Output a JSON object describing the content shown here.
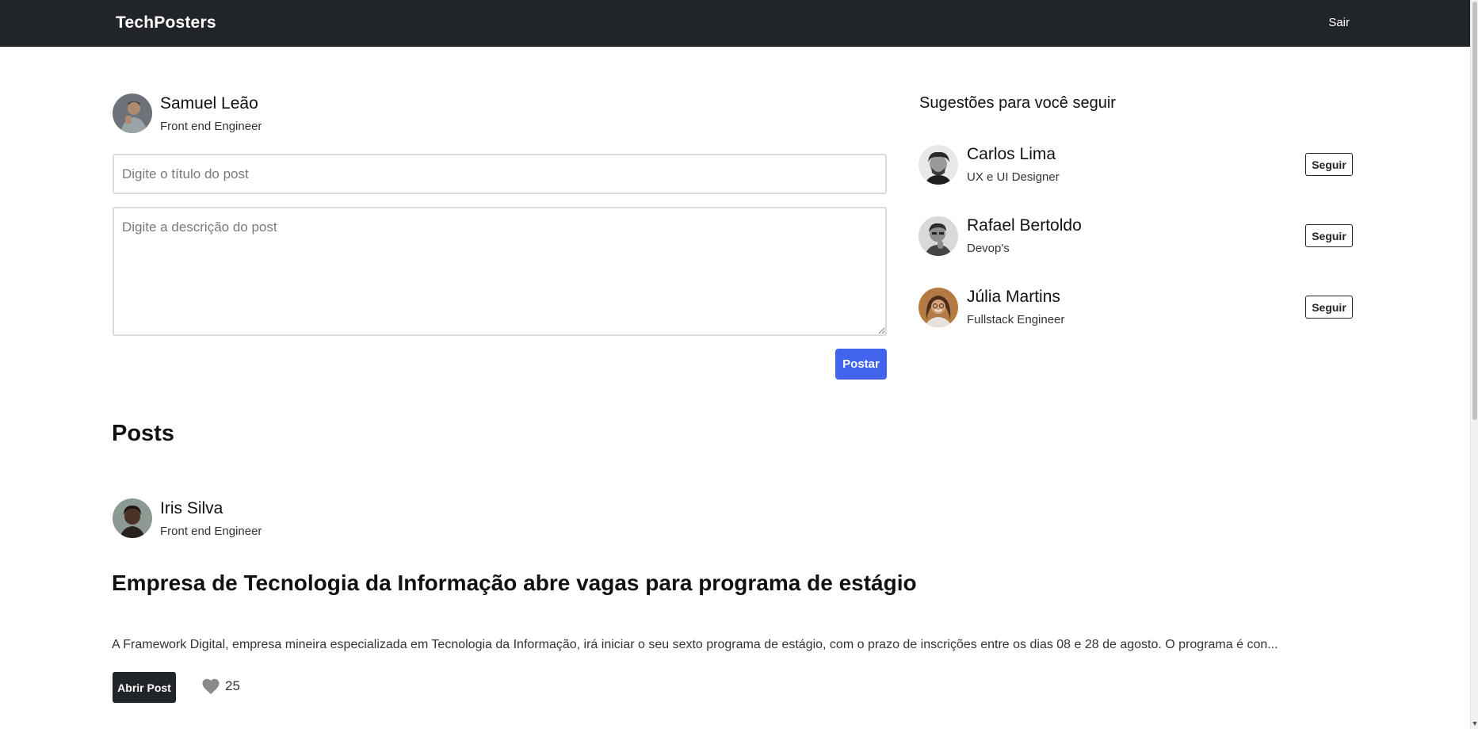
{
  "navbar": {
    "brand": "TechPosters",
    "logout_label": "Sair"
  },
  "current_user": {
    "name": "Samuel Leão",
    "role": "Front end Engineer"
  },
  "composer": {
    "title_placeholder": "Digite o título do post",
    "description_placeholder": "Digite a descrição do post",
    "submit_label": "Postar",
    "submit_color": "#4263eb"
  },
  "suggestions": {
    "title": "Sugestões para você seguir",
    "items": [
      {
        "name": "Carlos Lima",
        "role": "UX e UI Designer",
        "follow_label": "Seguir"
      },
      {
        "name": "Rafael Bertoldo",
        "role": "Devop's",
        "follow_label": "Seguir"
      },
      {
        "name": "Júlia Martins",
        "role": "Fullstack Engineer",
        "follow_label": "Seguir"
      }
    ]
  },
  "posts": {
    "heading": "Posts",
    "items": [
      {
        "author": "Iris Silva",
        "role": "Front end Engineer",
        "title": "Empresa de Tecnologia da Informação abre vagas para programa de estágio",
        "description": "A Framework Digital, empresa mineira especializada em Tecnologia da Informação, irá iniciar o seu sexto programa de estágio, com o prazo de inscrições entre os dias 08 e 28 de agosto. O programa é con...",
        "open_label": "Abrir Post",
        "likes": "25",
        "like_icon": "heart-icon"
      }
    ]
  },
  "colors": {
    "navbar_bg": "#212529",
    "primary": "#4263eb"
  }
}
